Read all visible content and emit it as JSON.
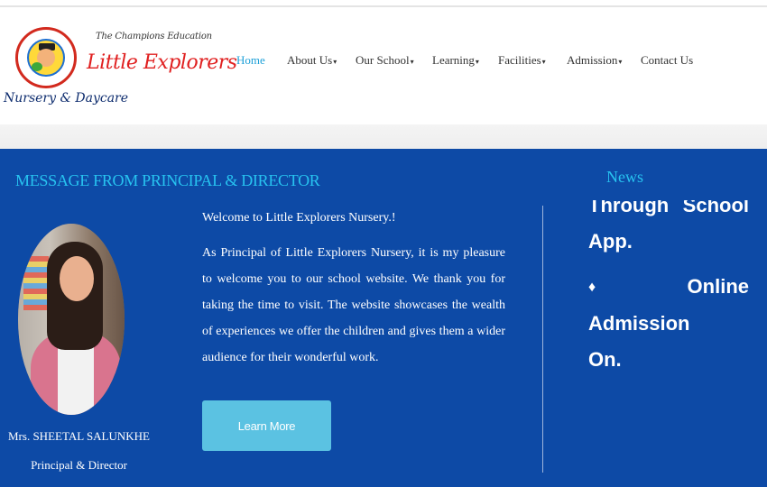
{
  "header": {
    "tagline": "The Champions Education",
    "brand_name": "Little Explorers",
    "brand_sub": "Nursery & Daycare"
  },
  "nav": {
    "items": [
      {
        "label": "Home",
        "caret": ""
      },
      {
        "label": "About Us",
        "caret": "▾"
      },
      {
        "label": "Our School",
        "caret": "▾"
      },
      {
        "label": "Learning",
        "caret": "▾"
      },
      {
        "label": "Facilities",
        "caret": "▾"
      },
      {
        "label": "Admission",
        "caret": "▾"
      },
      {
        "label": "Contact Us",
        "caret": ""
      }
    ]
  },
  "message": {
    "heading": "MESSAGE FROM PRINCIPAL & DIRECTOR",
    "welcome": "Welcome to Little Explorers Nursery.!",
    "body": "As Principal of Little Explorers Nursery, it is my pleasure to welcome you to our school website. We thank you for taking the time to visit. The website showcases the wealth of experiences we offer the children and gives them a wider audience for their wonderful work.",
    "button_label": "Learn More",
    "person_name": "Mrs. SHEETAL SALUNKHE",
    "person_role": "Principal & Director"
  },
  "news": {
    "title": "News",
    "item1_word1": "Through",
    "item1_word2": "School",
    "item1_word3": "App.",
    "bullet": "♦",
    "item2_line1": "Online Admission",
    "item2_line2": "On."
  },
  "colors": {
    "band": "#0d4aa6",
    "heading_accent": "#27c3f0",
    "button": "#5bc2e2",
    "brand_red": "#e02020",
    "nav_active": "#1ea0d8"
  },
  "icons": {
    "dropdown": "chevron-down-icon",
    "news_bullet": "diamond-bullet-icon"
  }
}
